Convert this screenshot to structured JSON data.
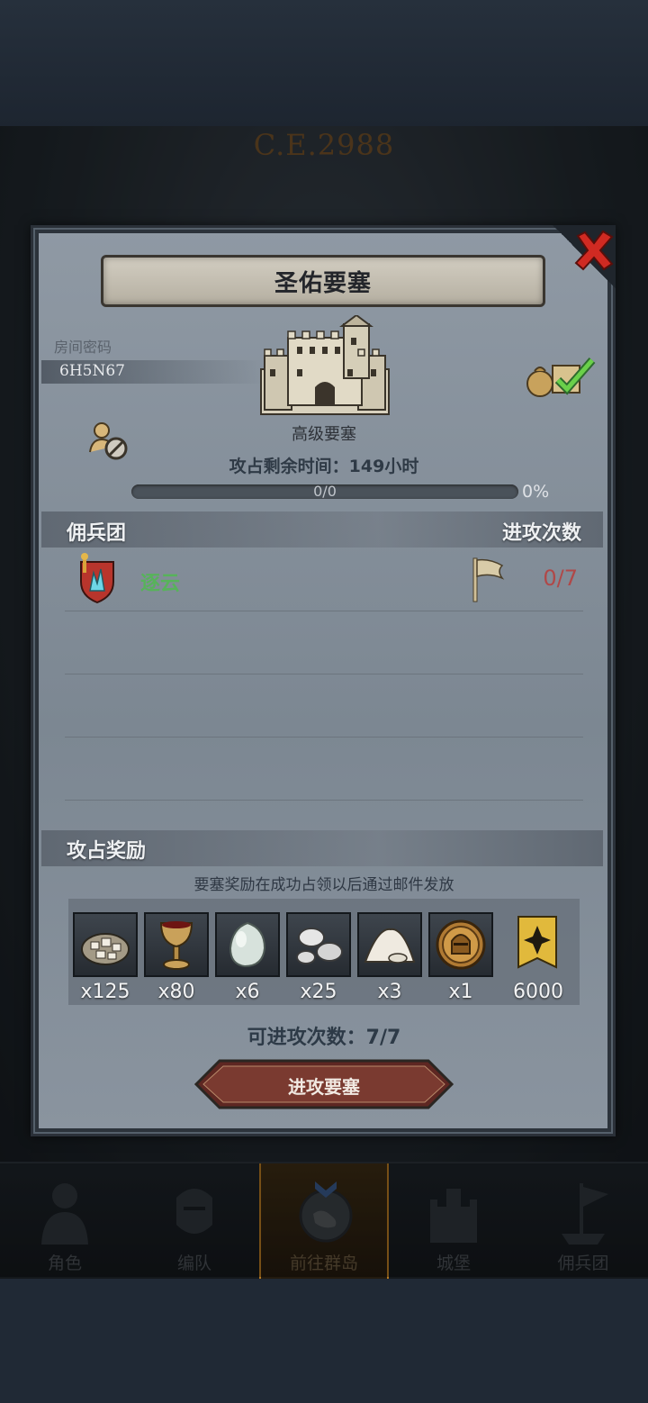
{
  "background": {
    "era_label": "C.E.2988"
  },
  "modal": {
    "title": "圣佑要塞",
    "room_code_label": "房间密码",
    "room_code": "6H5N67",
    "fortress_type": "高级要塞",
    "time_remaining": "攻占剩余时间：149小时",
    "progress": {
      "count_text": "0/0",
      "percent_text": "0%",
      "fraction": 0
    },
    "mercenary_header": "佣兵团",
    "attack_count_header": "进攻次数",
    "guilds": [
      {
        "name": "逐云",
        "attacks": "0/7"
      }
    ],
    "rewards_header": "攻占奖励",
    "reward_note": "要塞奖励在成功占领以后通过邮件发放",
    "rewards": [
      {
        "icon": "ore-pile-icon",
        "qty": "x125"
      },
      {
        "icon": "goblet-icon",
        "qty": "x80"
      },
      {
        "icon": "moonstone-icon",
        "qty": "x6"
      },
      {
        "icon": "silver-orbs-icon",
        "qty": "x25"
      },
      {
        "icon": "powder-pile-icon",
        "qty": "x3"
      },
      {
        "icon": "knight-medal-icon",
        "qty": "x1"
      },
      {
        "icon": "guild-banner-icon",
        "qty": "6000"
      }
    ],
    "attempts_text": "可进攻次数：7/7",
    "attack_button": "进攻要塞"
  },
  "bottom_nav": [
    {
      "label": "角色",
      "icon": "character-icon",
      "active": false
    },
    {
      "label": "编队",
      "icon": "formation-icon",
      "active": false
    },
    {
      "label": "前往群岛",
      "icon": "islands-icon",
      "active": true
    },
    {
      "label": "城堡",
      "icon": "castle-icon",
      "active": false
    },
    {
      "label": "佣兵团",
      "icon": "mercenary-icon",
      "active": false
    }
  ],
  "colors": {
    "guild_name": "#57b35a",
    "attack_count": "#b04848",
    "active_nav": "#b67a22"
  }
}
